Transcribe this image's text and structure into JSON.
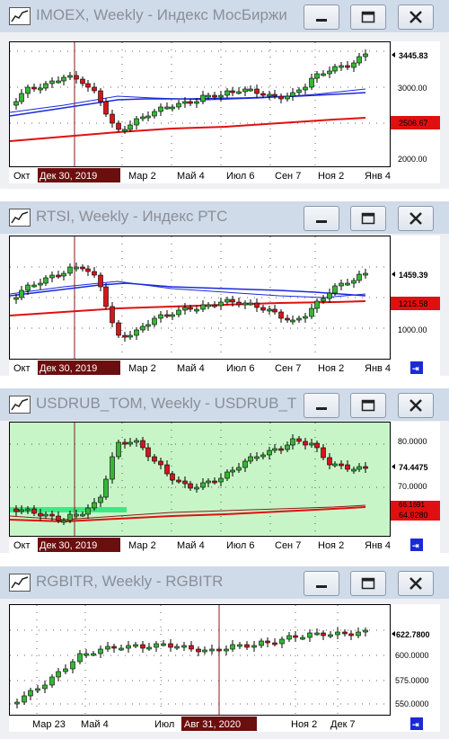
{
  "windows": [
    {
      "id": "imoex",
      "title": "IMOEX, Weekly - Индекс МосБиржи",
      "price_labels": [
        "3000.00",
        "2000.00"
      ],
      "current_value": "3445.83",
      "ma_value": "2506.67",
      "x_labels": [
        "Окт",
        "Мар 2",
        "Май 4",
        "Июл 6",
        "Сен 7",
        "Ноя 2",
        "Янв 4"
      ],
      "highlighted_date": "Дек 30, 2019"
    },
    {
      "id": "rtsi",
      "title": "RTSI, Weekly - Индекс РТС",
      "price_labels": [
        "1000.00"
      ],
      "current_value": "1459.39",
      "ma_value": "1215.58",
      "x_labels": [
        "Окт",
        "Мар 2",
        "Май 4",
        "Июл 6",
        "Сен 7",
        "Ноя 2",
        "Янв 4"
      ],
      "highlighted_date": "Дек 30, 2019"
    },
    {
      "id": "usdrub",
      "title": "USDRUB_TOM, Weekly - USDRUB_T...",
      "price_labels": [
        "80.0000",
        "70.0000"
      ],
      "current_value": "74.4475",
      "ma_value": "64.9280",
      "ma_value_2": "66.1691",
      "x_labels": [
        "Окт",
        "Мар 2",
        "Май 4",
        "Июл 6",
        "Сен 7",
        "Ноя 2",
        "Янв 4"
      ],
      "highlighted_date": "Дек 30, 2019"
    },
    {
      "id": "rgbitr",
      "title": "RGBITR, Weekly - RGBITR",
      "price_labels": [
        "600.0000",
        "575.0000",
        "550.0000"
      ],
      "current_value": "622.7800",
      "x_labels": [
        "Мар 23",
        "Май 4",
        "Июл",
        "Ноя 2",
        "Дек 7"
      ],
      "highlighted_date": "Авг 31, 2020"
    }
  ],
  "colors": {
    "titlebar": "#cfdbe9",
    "up_candle": "#34b834",
    "down_candle": "#d8141c",
    "ma_slow": "#e01010",
    "ma_fast": "#1a2ad8",
    "usd_background": "#c8f5c8",
    "crosshair": "#8b1a1a",
    "scroll_button": "#1a2ad8"
  },
  "icons": [
    "chart-icon",
    "minimize-icon",
    "maximize-icon",
    "close-icon",
    "scroll-end-icon"
  ]
}
